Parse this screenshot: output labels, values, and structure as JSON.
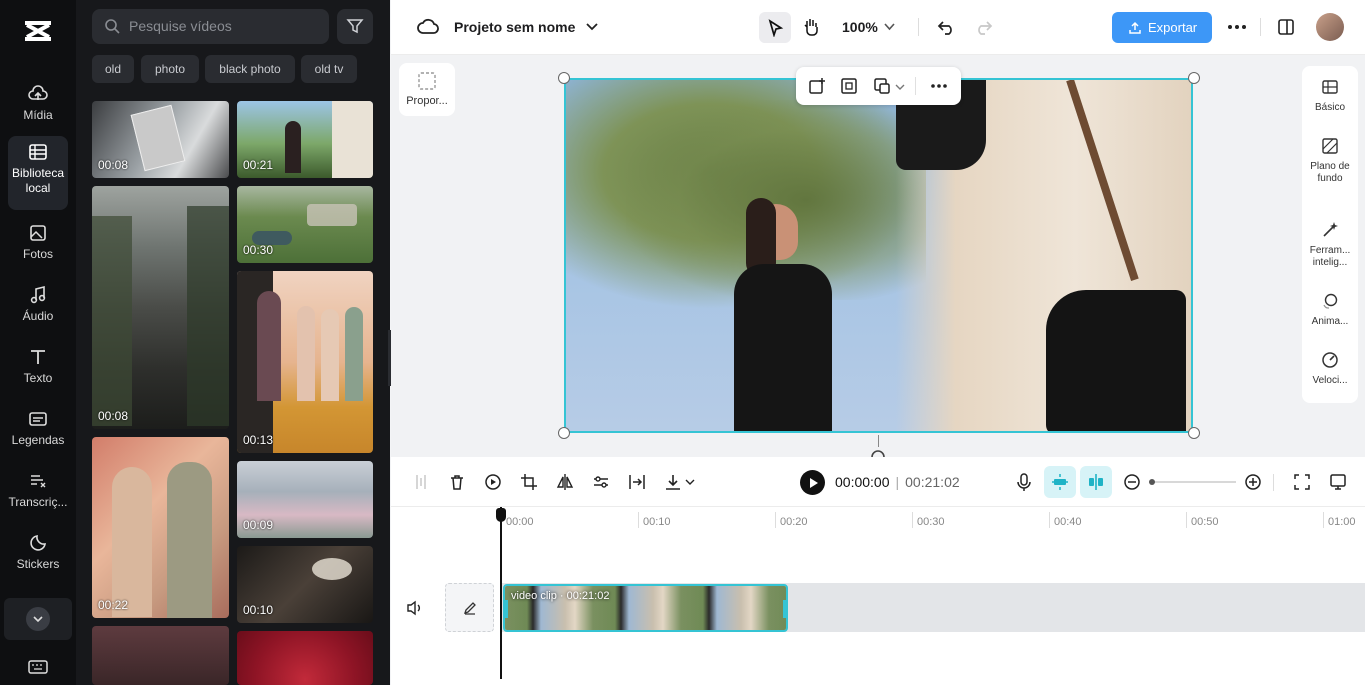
{
  "leftnav": {
    "items": [
      {
        "label": "Mídia",
        "icon": "cloud-upload-icon"
      },
      {
        "label": "Biblioteca local",
        "icon": "library-icon"
      },
      {
        "label": "Fotos",
        "icon": "image-icon"
      },
      {
        "label": "Áudio",
        "icon": "music-note-icon"
      },
      {
        "label": "Texto",
        "icon": "text-icon"
      },
      {
        "label": "Legendas",
        "icon": "captions-icon"
      },
      {
        "label": "Transcriç...",
        "icon": "transcript-icon"
      },
      {
        "label": "Stickers",
        "icon": "sticker-icon"
      }
    ]
  },
  "media": {
    "search_placeholder": "Pesquise vídeos",
    "tags": [
      "old",
      "photo",
      "black photo",
      "old tv"
    ],
    "thumbs": [
      {
        "duration": "00:08"
      },
      {
        "duration": "00:21"
      },
      {
        "duration": "00:30"
      },
      {
        "duration": "00:08"
      },
      {
        "duration": "00:13"
      },
      {
        "duration": "00:09"
      },
      {
        "duration": "00:22"
      },
      {
        "duration": "00:10"
      }
    ]
  },
  "topbar": {
    "project_name": "Projeto sem nome",
    "zoom": "100%",
    "export_label": "Exportar"
  },
  "canvas": {
    "ratio_label": "Propor..."
  },
  "rightpanel": {
    "items": [
      {
        "label": "Básico"
      },
      {
        "label": "Plano de fundo"
      },
      {
        "label": "Ferram... intelig..."
      },
      {
        "label": "Anima..."
      },
      {
        "label": "Veloci..."
      }
    ]
  },
  "timeline": {
    "current_time": "00:00:00",
    "total_time": "00:21:02",
    "ticks": [
      "00:00",
      "00:10",
      "00:20",
      "00:30",
      "00:40",
      "00:50",
      "01:00"
    ],
    "clip_label": "video clip · 00:21:02"
  },
  "colors": {
    "accent": "#35c4d4",
    "export": "#3d97f7"
  }
}
